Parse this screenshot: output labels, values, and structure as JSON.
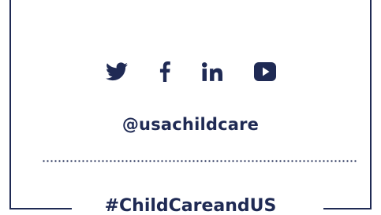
{
  "social": {
    "icons": [
      {
        "name": "twitter-icon"
      },
      {
        "name": "facebook-icon"
      },
      {
        "name": "linkedin-icon"
      },
      {
        "name": "youtube-icon"
      }
    ],
    "handle": "@usachildcare",
    "hashtag": "#ChildCareandUS"
  },
  "colors": {
    "brand": "#1f2a54",
    "background": "#ffffff"
  }
}
